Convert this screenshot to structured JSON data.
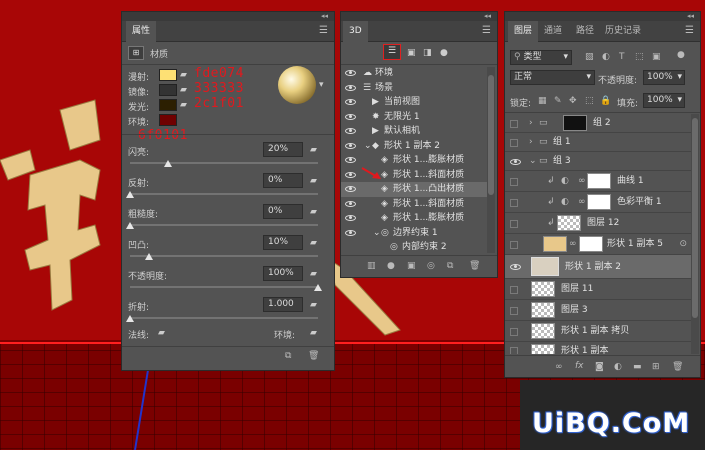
{
  "properties": {
    "tab": "属性",
    "header_label": "材质",
    "labels": {
      "diffuse": "漫射:",
      "specular": "镜像:",
      "illumination": "发光:",
      "ambient": "环境:"
    },
    "colors": {
      "diffuse": "#fde074",
      "specular": "#333333",
      "illumination": "#2c1f01",
      "ambient": "#6f0101"
    },
    "annotations": {
      "diffuse": "fde074",
      "specular": "333333",
      "illumination": "2c1f01",
      "ambient": "6f0101"
    },
    "sliders": [
      {
        "label": "闪亮:",
        "value": "20%",
        "level": 0.2
      },
      {
        "label": "反射:",
        "value": "0%",
        "level": 0.0
      },
      {
        "label": "粗糙度:",
        "value": "0%",
        "level": 0.0
      },
      {
        "label": "凹凸:",
        "value": "10%",
        "level": 0.1
      },
      {
        "label": "不透明度:",
        "value": "100%",
        "level": 1.0
      },
      {
        "label": "折射:",
        "value": "1.000",
        "level": 0.0
      }
    ],
    "normal_label": "法线:",
    "environment_label": "环境:"
  },
  "panel3d": {
    "tab": "3D",
    "items": [
      {
        "label": "环境",
        "indent": 0,
        "icon": "environment-icon",
        "eye": true
      },
      {
        "label": "场景",
        "indent": 0,
        "icon": "scene-icon",
        "eye": true
      },
      {
        "label": "当前视图",
        "indent": 1,
        "icon": "camera-icon",
        "eye": true
      },
      {
        "label": "无限光 1",
        "indent": 1,
        "icon": "light-icon",
        "eye": true
      },
      {
        "label": "默认相机",
        "indent": 1,
        "icon": "camera-icon",
        "eye": true
      },
      {
        "label": "形状 1 副本 2",
        "indent": 1,
        "icon": "mesh-icon",
        "eye": true
      },
      {
        "label": "形状 1...膨胀材质",
        "indent": 2,
        "icon": "material-icon",
        "eye": true
      },
      {
        "label": "形状 1...斜面材质",
        "indent": 2,
        "icon": "material-icon",
        "eye": true
      },
      {
        "label": "形状 1...凸出材质",
        "indent": 2,
        "icon": "material-icon",
        "eye": true,
        "selected": true
      },
      {
        "label": "形状 1...斜面材质",
        "indent": 2,
        "icon": "material-icon",
        "eye": true
      },
      {
        "label": "形状 1...膨胀材质",
        "indent": 2,
        "icon": "material-icon",
        "eye": true
      },
      {
        "label": "边界约束 1",
        "indent": 2,
        "icon": "constraint-icon",
        "eye": true
      },
      {
        "label": "内部约束 2",
        "indent": 3,
        "icon": "constraint-icon",
        "eye": false
      }
    ]
  },
  "layers": {
    "tabs": [
      "图层",
      "通道",
      "路径",
      "历史记录"
    ],
    "filter_type": "类型",
    "blend_mode": "正常",
    "opacity_label": "不透明度:",
    "opacity_value": "100%",
    "lock_label": "锁定:",
    "fill_label": "填充:",
    "fill_value": "100%",
    "rows": [
      {
        "name": "组 2",
        "kind": "group",
        "eye": false,
        "collapsed": true
      },
      {
        "name": "组 1",
        "kind": "group",
        "eye": false,
        "collapsed": true
      },
      {
        "name": "组 3",
        "kind": "group",
        "eye": true,
        "collapsed": false
      },
      {
        "name": "曲线 1",
        "kind": "adjustment",
        "eye": false
      },
      {
        "name": "色彩平衡 1",
        "kind": "adjustment",
        "eye": false
      },
      {
        "name": "图层 12",
        "kind": "pixel",
        "eye": false
      },
      {
        "name": "形状 1 副本 5",
        "kind": "smart",
        "eye": false
      },
      {
        "name": "形状 1 副本 2",
        "kind": "3d",
        "eye": true,
        "selected": true
      },
      {
        "name": "图层 11",
        "kind": "pixel",
        "eye": false
      },
      {
        "name": "图层 3",
        "kind": "pixel",
        "eye": false
      },
      {
        "name": "形状 1 副本 拷贝",
        "kind": "pixel",
        "eye": false
      },
      {
        "name": "形状 1 副本",
        "kind": "pixel",
        "eye": false
      }
    ]
  },
  "watermark": "UiBQ.CoM"
}
